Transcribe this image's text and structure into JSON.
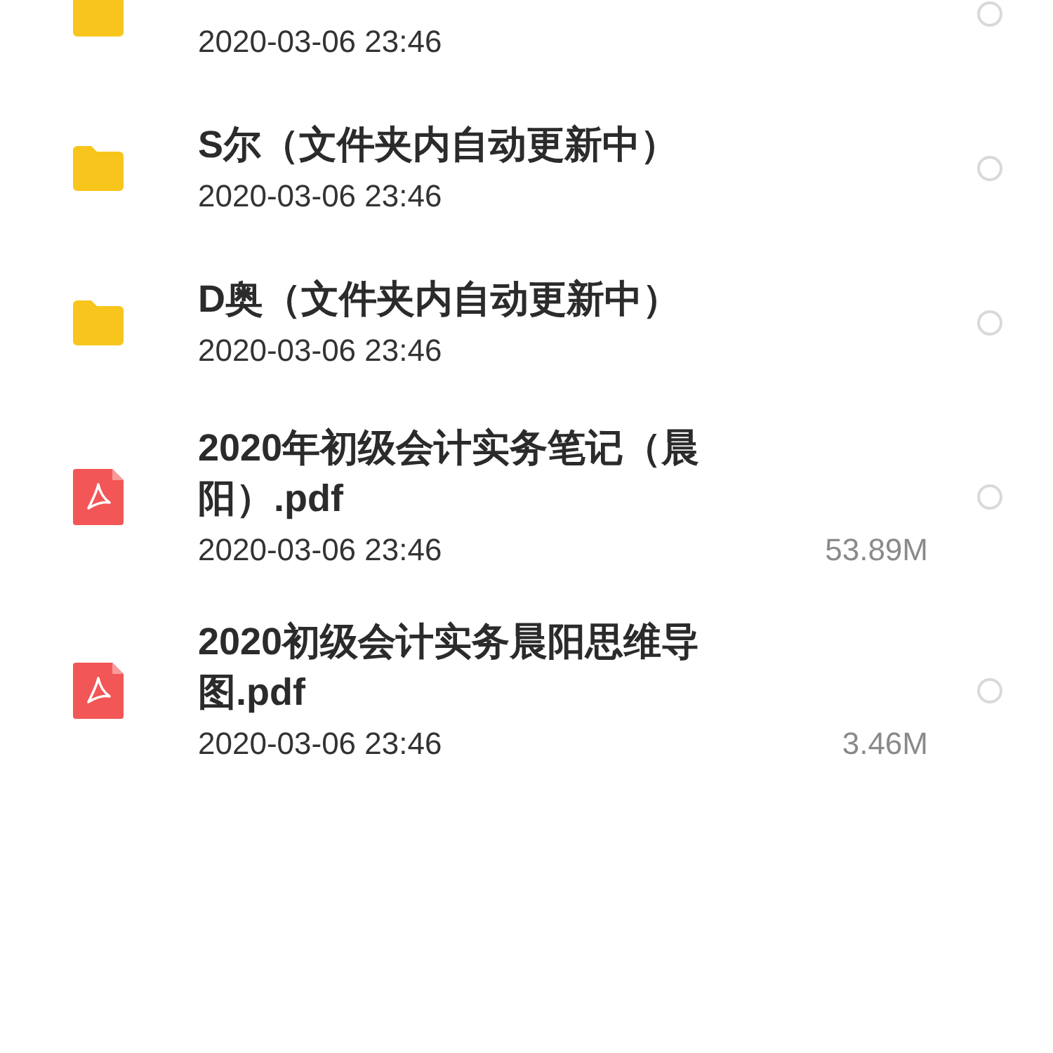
{
  "files": [
    {
      "kind": "folder",
      "date": "2020-03-06 23:46",
      "selected": false
    },
    {
      "kind": "folder",
      "name": "S尔（文件夹内自动更新中）",
      "date": "2020-03-06 23:46",
      "selected": false
    },
    {
      "kind": "folder",
      "name": "D奥（文件夹内自动更新中）",
      "date": "2020-03-06 23:46",
      "selected": false
    },
    {
      "kind": "pdf",
      "name": "2020年初级会计实务笔记（晨阳）.pdf",
      "date": "2020-03-06 23:46",
      "size": "53.89M",
      "selected": false
    },
    {
      "kind": "pdf",
      "name": "2020初级会计实务晨阳思维导图.pdf",
      "date": "2020-03-06 23:46",
      "size": "3.46M",
      "selected": false
    }
  ]
}
